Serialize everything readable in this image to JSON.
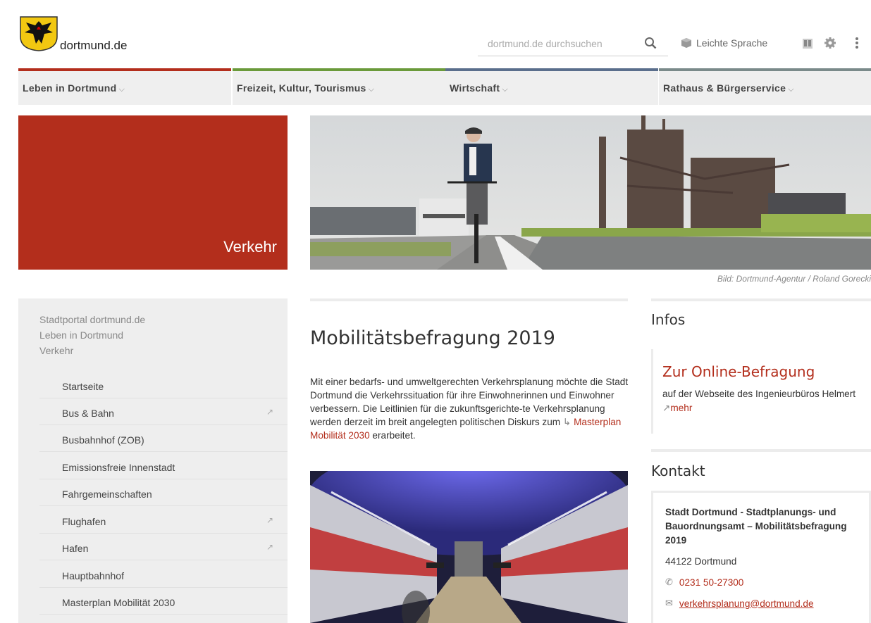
{
  "header": {
    "site_name": "dortmund.de",
    "search_placeholder": "dortmund.de durchsuchen",
    "easy_language": "Leichte Sprache"
  },
  "nav": [
    {
      "label": "Leben in Dortmund",
      "color": "#b32e1c"
    },
    {
      "label": "Freizeit, Kultur, Tourismus",
      "color": "#6a9a3a"
    },
    {
      "label": "Wirtschaft",
      "color": "#5a6e8c"
    },
    {
      "label": "Rathaus & Bürgerservice",
      "color": "#7a8a8a"
    }
  ],
  "section": {
    "title": "Verkehr"
  },
  "hero": {
    "credit": "Bild: Dortmund-Agentur / Roland Gorecki"
  },
  "breadcrumb": [
    "Stadtportal dortmund.de",
    "Leben in Dortmund",
    "Verkehr"
  ],
  "sidebar": {
    "items": [
      {
        "label": "Startseite",
        "external": false
      },
      {
        "label": "Bus & Bahn",
        "external": true
      },
      {
        "label": "Busbahnhof (ZOB)",
        "external": false
      },
      {
        "label": "Emissionsfreie Innenstadt",
        "external": false
      },
      {
        "label": "Fahrgemeinschaften",
        "external": false
      },
      {
        "label": "Flughafen",
        "external": true
      },
      {
        "label": "Hafen",
        "external": true
      },
      {
        "label": "Hauptbahnhof",
        "external": false
      },
      {
        "label": "Masterplan Mobilität 2030",
        "external": false
      }
    ]
  },
  "main": {
    "title": "Mobilitätsbefragung 2019",
    "text_before": "Mit einer bedarfs- und umweltgerechten Verkehrsplanung möchte die Stadt Dortmund die Verkehrssituation für ihre Einwohnerinnen und Einwohner verbessern. Die Leitlinien für die zukunftsgerichte-te Verkehrsplanung werden derzeit im breit angelegten politischen Diskurs zum",
    "link_arrow": "↳",
    "link_text": "Masterplan Mobilität 2030",
    "text_after": "erarbeitet."
  },
  "infos": {
    "heading": "Infos",
    "link": "Zur Online-Befragung",
    "desc": "auf der Webseite des Ingenieurbüros Helmert",
    "more": "mehr"
  },
  "contact": {
    "heading": "Kontakt",
    "name": "Stadt Dortmund - Stadtplanungs- und Bauordnungsamt – Mobilitätsbefragung 2019",
    "city": "44122 Dortmund",
    "phone": "0231 50-27300",
    "email": "verkehrsplanung@dortmund.de"
  }
}
